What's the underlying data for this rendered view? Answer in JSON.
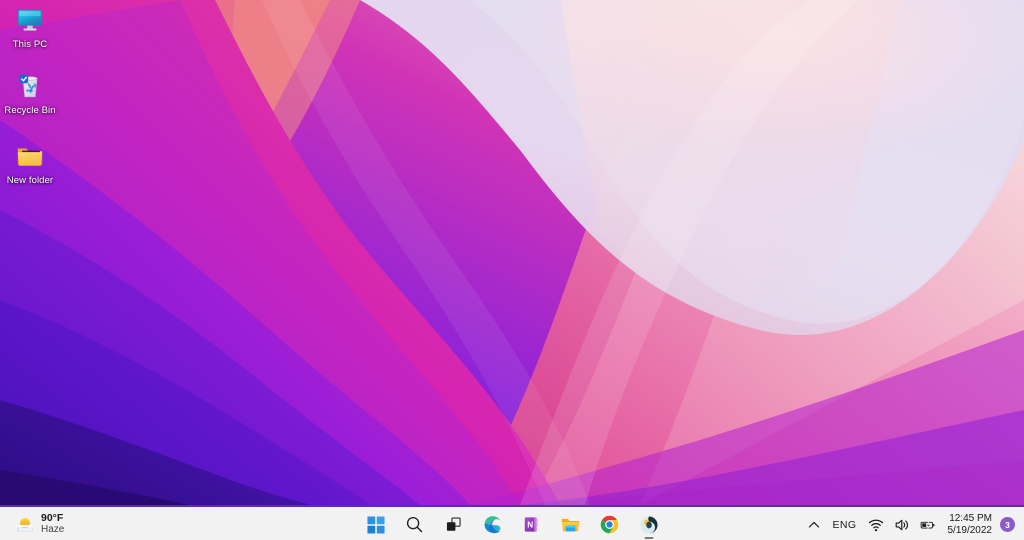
{
  "desktop": {
    "wallpaper_name": "abstract-flow-purple-pink",
    "wallpaper_colors": {
      "deep_violet": "#4b15c4",
      "royal_purple": "#7a1fd6",
      "magenta": "#c31cc7",
      "hot_pink": "#e5388f",
      "rose": "#ef6fa6",
      "pale_pink": "#f3c8da",
      "lavender_white": "#ddd8ec",
      "blush": "#f6dfe4"
    },
    "icons": [
      {
        "id": "this-pc",
        "label": "This PC",
        "icon": "monitor-icon"
      },
      {
        "id": "recycle-bin",
        "label": "Recycle Bin",
        "icon": "recycle-bin-icon"
      },
      {
        "id": "new-folder",
        "label": "New folder",
        "icon": "folder-icon"
      }
    ]
  },
  "taskbar": {
    "background": "#f2f2f3",
    "accent_line": "#5b2fa8",
    "weather": {
      "temperature": "90°F",
      "condition": "Haze",
      "icon": "sun-haze-icon"
    },
    "buttons": [
      {
        "id": "start",
        "label": "Start",
        "icon": "windows-logo-icon",
        "running": false
      },
      {
        "id": "search",
        "label": "Search",
        "icon": "search-icon",
        "running": false
      },
      {
        "id": "task-view",
        "label": "Task View",
        "icon": "task-view-icon",
        "running": false
      },
      {
        "id": "edge",
        "label": "Microsoft Edge",
        "icon": "edge-icon",
        "running": false
      },
      {
        "id": "onenote",
        "label": "OneNote",
        "icon": "onenote-icon",
        "running": false
      },
      {
        "id": "file-explorer",
        "label": "File Explorer",
        "icon": "file-explorer-icon",
        "running": false
      },
      {
        "id": "chrome",
        "label": "Google Chrome",
        "icon": "chrome-icon",
        "running": false
      },
      {
        "id": "app8",
        "label": "App",
        "icon": "teal-moon-icon",
        "running": true
      }
    ],
    "tray": {
      "overflow_label": "Show hidden icons",
      "overflow_icon": "chevron-up-icon",
      "language": "ENG",
      "network_icon": "wifi-icon",
      "volume_icon": "speaker-icon",
      "battery_icon": "battery-charging-icon",
      "time": "12:45 PM",
      "date": "5/19/2022",
      "notification_count": "3",
      "notification_badge_color": "#8b5cc7"
    }
  }
}
